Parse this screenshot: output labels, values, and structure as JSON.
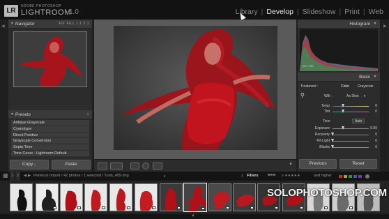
{
  "app": {
    "logo_badge": "LR",
    "logo_small": "ADOBE PHOTOSHOP",
    "logo_big": "LIGHTROOM",
    "version": "1.0"
  },
  "modules": [
    "Library",
    "Develop",
    "Slideshow",
    "Print",
    "Web"
  ],
  "active_module": "Develop",
  "navigator": {
    "title": "Navigator",
    "zoom_options": [
      "FIT",
      "FILL",
      "1:1",
      "3:1"
    ]
  },
  "presets": {
    "title": "Presets",
    "add": "+",
    "items": [
      "Antique Grayscale",
      "Cyanotype",
      "Direct Positive",
      "Grayscale Conversion",
      "Sepia Tone",
      "Tone Curve - Lightroom Default"
    ]
  },
  "left_buttons": {
    "copy": "Copy...",
    "paste": "Paste"
  },
  "histogram": {
    "title": "Histogram",
    "iso": "ISO 100"
  },
  "basic": {
    "title": "Basic",
    "treatment_label": "Treatment :",
    "treatment_color": "Color",
    "treatment_gray": "Grayscale",
    "wb_label": "WB :",
    "wb_value": "As Shot",
    "temp_label": "Temp",
    "temp_value": "0",
    "tint_label": "Tint",
    "tint_value": "0",
    "tone_label": "Tone",
    "tone_auto": "Auto",
    "exposure_label": "Exposure",
    "exposure_value": "0.00",
    "recovery_label": "Recovery",
    "recovery_value": "0",
    "filllight_label": "Fill Light",
    "filllight_value": "0",
    "blacks_label": "Blacks",
    "blacks_value": "0"
  },
  "right_buttons": {
    "previous": "Previous",
    "reset": "Reset"
  },
  "filmbar": {
    "page1": "1",
    "page2": "2",
    "source": "Previous Import / 42 photos / 1 selected / Turin_459.dng",
    "filters_label": "Filters",
    "rating_filter": "and higher"
  },
  "watermark": "SOLOPHOTOSHOP.COM",
  "colors": {
    "accent_dress": "#b0141c",
    "background": "#1f1f1f",
    "panel": "#2c2c2c"
  }
}
